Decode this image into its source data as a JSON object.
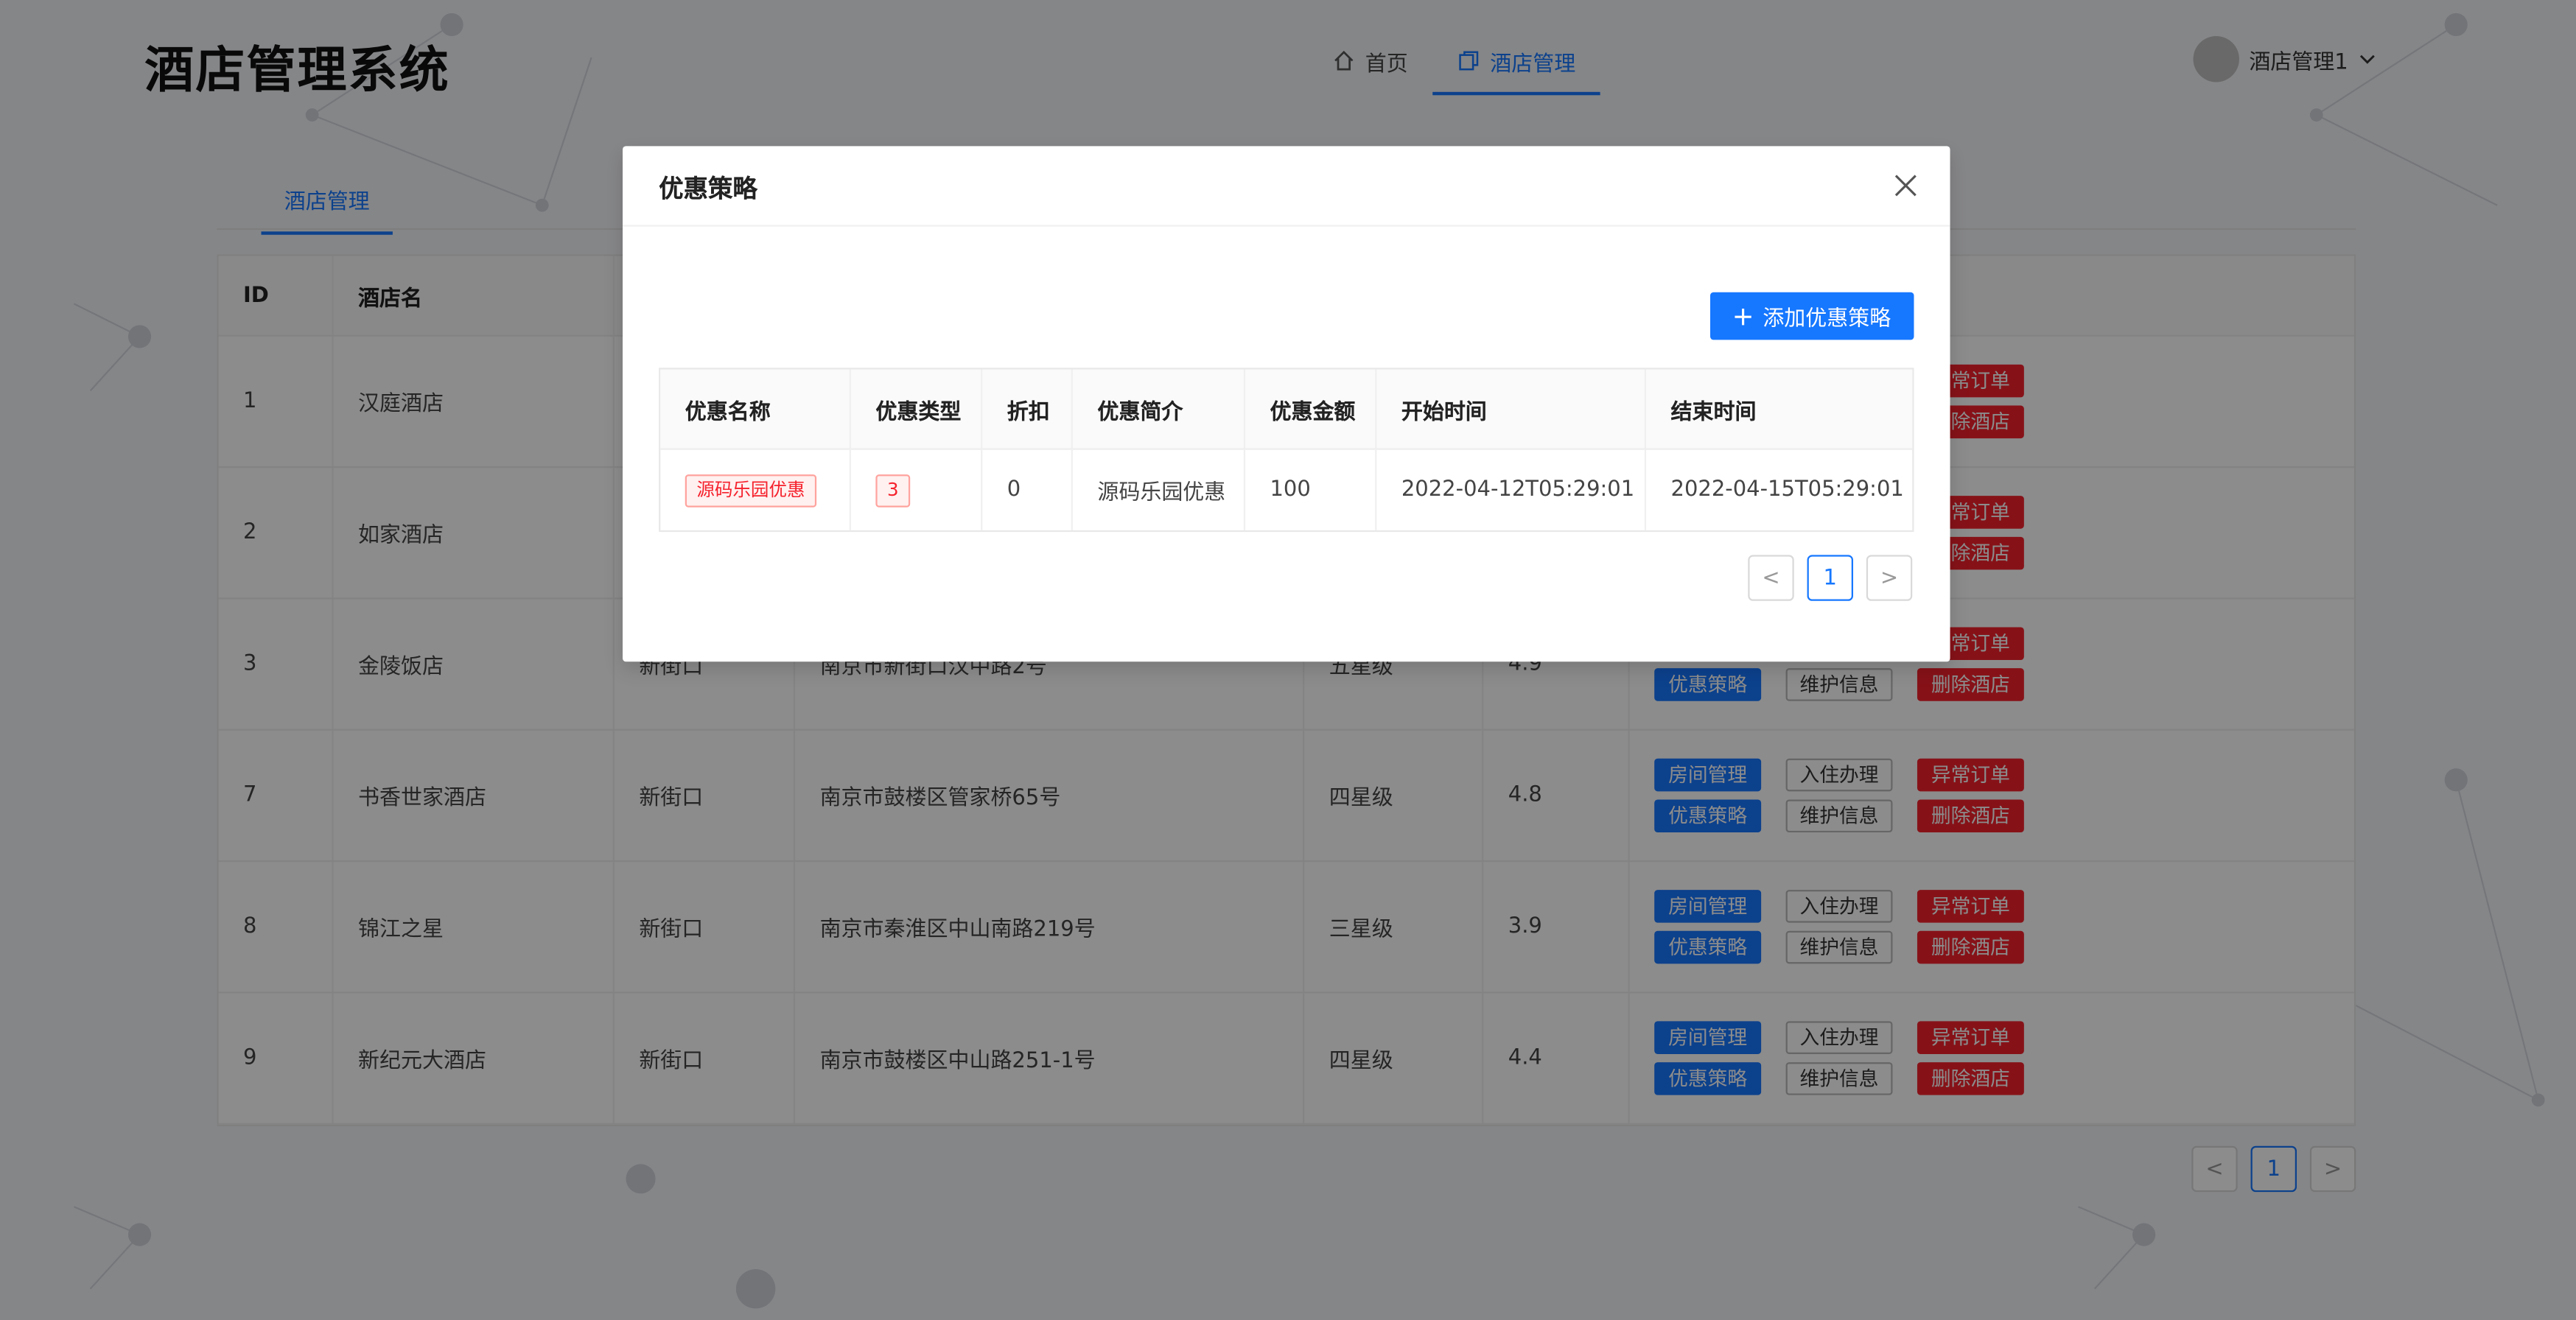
{
  "header": {
    "brand": "酒店管理系统",
    "nav": [
      {
        "label": "首页",
        "icon": "home-icon"
      },
      {
        "label": "酒店管理",
        "icon": "copy-icon"
      }
    ],
    "user": "酒店管理1"
  },
  "subtab": "酒店管理",
  "main_table": {
    "headers": [
      "ID",
      "酒店名",
      "",
      "",
      "",
      "",
      ""
    ],
    "rows": [
      {
        "id": "1",
        "name": "汉庭酒店",
        "area": "",
        "address": "",
        "star": "",
        "rate": ""
      },
      {
        "id": "2",
        "name": "如家酒店",
        "area": "",
        "address": "",
        "star": "",
        "rate": ""
      },
      {
        "id": "3",
        "name": "金陵饭店",
        "area": "新街口",
        "address": "南京市新街口汉中路2号",
        "star": "五星级",
        "rate": "4.9"
      },
      {
        "id": "7",
        "name": "书香世家酒店",
        "area": "新街口",
        "address": "南京市鼓楼区管家桥65号",
        "star": "四星级",
        "rate": "4.8"
      },
      {
        "id": "8",
        "name": "锦江之星",
        "area": "新街口",
        "address": "南京市秦淮区中山南路219号",
        "star": "三星级",
        "rate": "3.9"
      },
      {
        "id": "9",
        "name": "新纪元大酒店",
        "area": "新街口",
        "address": "南京市鼓楼区中山路251-1号",
        "star": "四星级",
        "rate": "4.4"
      }
    ],
    "ops": {
      "room": "房间管理",
      "checkin": "入住办理",
      "abnormal": "异常订单",
      "discount": "优惠策略",
      "maintain": "维护信息",
      "delete": "删除酒店"
    }
  },
  "pagination": {
    "prev": "<",
    "page": "1",
    "next": ">"
  },
  "modal": {
    "title": "优惠策略",
    "add_button": "添加优惠策略",
    "headers": [
      "优惠名称",
      "优惠类型",
      "折扣",
      "优惠简介",
      "优惠金额",
      "开始时间",
      "结束时间"
    ],
    "rows": [
      {
        "name": "源码乐园优惠",
        "type": "3",
        "discount": "0",
        "intro": "源码乐园优惠",
        "amount": "100",
        "start": "2022-04-12T05:29:01",
        "end": "2022-04-15T05:29:01"
      }
    ],
    "pagination": {
      "prev": "<",
      "page": "1",
      "next": ">"
    }
  },
  "colors": {
    "primary": "#1677ff",
    "danger": "#f5222d",
    "mask": "rgba(0,0,0,0.45)"
  }
}
